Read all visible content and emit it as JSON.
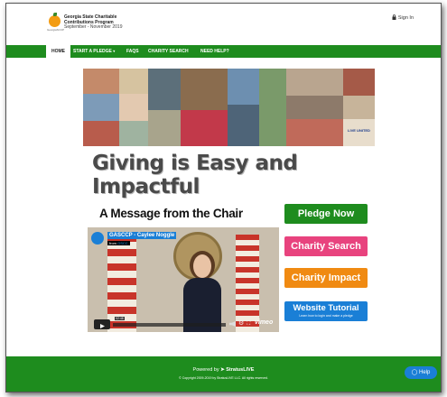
{
  "header": {
    "org_line1": "Georgia State Charitable",
    "org_line2": "Contributions Program",
    "org_dates": "September - November 2019",
    "logo_caption": "GeorgiaSCCP",
    "signin_label": "Sign In"
  },
  "nav": {
    "items": [
      {
        "label": "HOME"
      },
      {
        "label": "START A PLEDGE"
      },
      {
        "label": "FAQS"
      },
      {
        "label": "CHARITY SEARCH"
      },
      {
        "label": "NEED HELP?"
      }
    ]
  },
  "hero": {
    "tagline": "Giving is Easy and Impactful",
    "collage_sign_text": "LIVE UNITED"
  },
  "main": {
    "chair_title": "A Message from the Chair"
  },
  "video": {
    "title": "GASCCP - Caylee Noggle",
    "from_text": "from",
    "from_user": "GSCC",
    "timestamp": "02:48",
    "vimeo_label": "vimeo"
  },
  "buttons": {
    "pledge": {
      "label": "Pledge Now",
      "color": "#1e8c1e"
    },
    "search": {
      "label": "Charity Search",
      "color": "#e8437e"
    },
    "impact": {
      "label": "Charity Impact",
      "color": "#f08a12"
    },
    "tutorial": {
      "label": "Website Tutorial",
      "sub": "Learn how to login and make a pledge",
      "color": "#1a7fd6"
    }
  },
  "footer": {
    "powered_by": "Powered by",
    "brand": "StratusLIVE",
    "copyright": "© Copyright 2009-2019 by StratusLIVE LLC. All rights reserved."
  },
  "help": {
    "label": "Help"
  },
  "icons": {
    "lock": "lock-icon",
    "dropdown": "chevron-down-icon",
    "play": "play-icon",
    "help": "chat-icon"
  }
}
